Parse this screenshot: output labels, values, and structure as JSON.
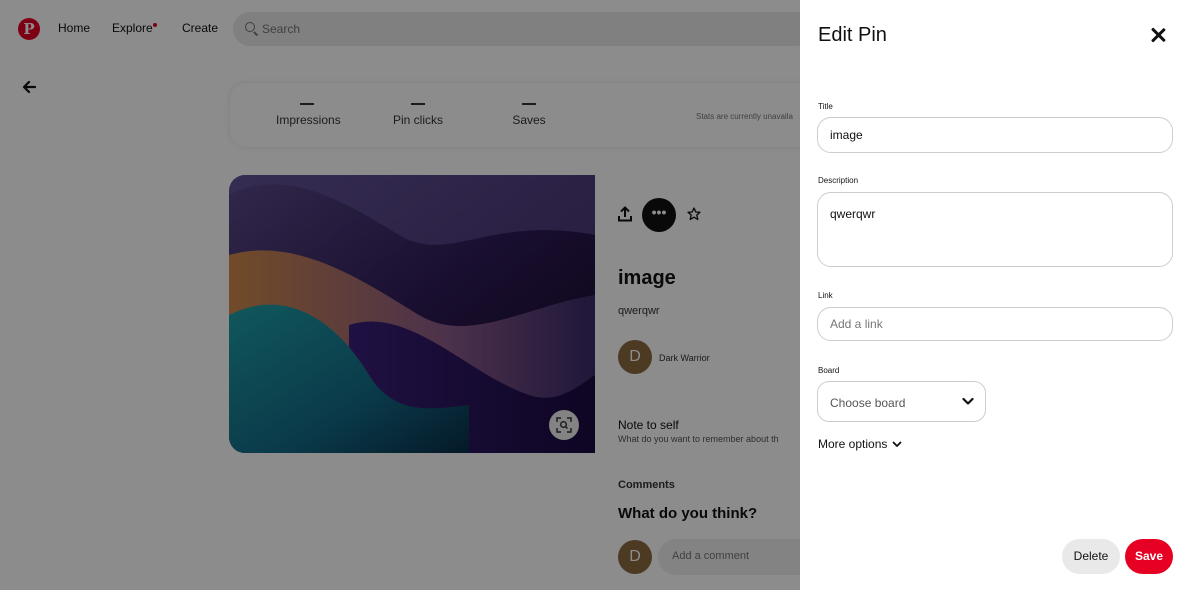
{
  "nav": {
    "logo": "P",
    "home": "Home",
    "explore": "Explore",
    "create": "Create",
    "search_placeholder": "Search"
  },
  "stats": {
    "impressions_value": "—",
    "impressions_label": "Impressions",
    "pin_clicks_value": "—",
    "pin_clicks_label": "Pin clicks",
    "saves_value": "—",
    "saves_label": "Saves",
    "note": "Stats are currently unavaila"
  },
  "pin": {
    "title": "image",
    "description": "qwerqwr",
    "owner_initial": "D",
    "owner_name": "Dark Warrior",
    "note_title": "Note to self",
    "note_sub": "What do you want to remember about th",
    "comments_label": "Comments",
    "think": "What do you think?",
    "me_initial": "D",
    "comment_placeholder": "Add a comment"
  },
  "edit_panel": {
    "title": "Edit Pin",
    "title_label": "Title",
    "title_value": "image",
    "description_label": "Description",
    "description_value": "qwerqwr",
    "link_label": "Link",
    "link_placeholder": "Add a link",
    "board_label": "Board",
    "board_placeholder": "Choose board",
    "more_options": "More options",
    "delete": "Delete",
    "save": "Save"
  },
  "colors": {
    "brand": "#e60023",
    "overlay": "rgba(0,0,0,0.45)"
  }
}
